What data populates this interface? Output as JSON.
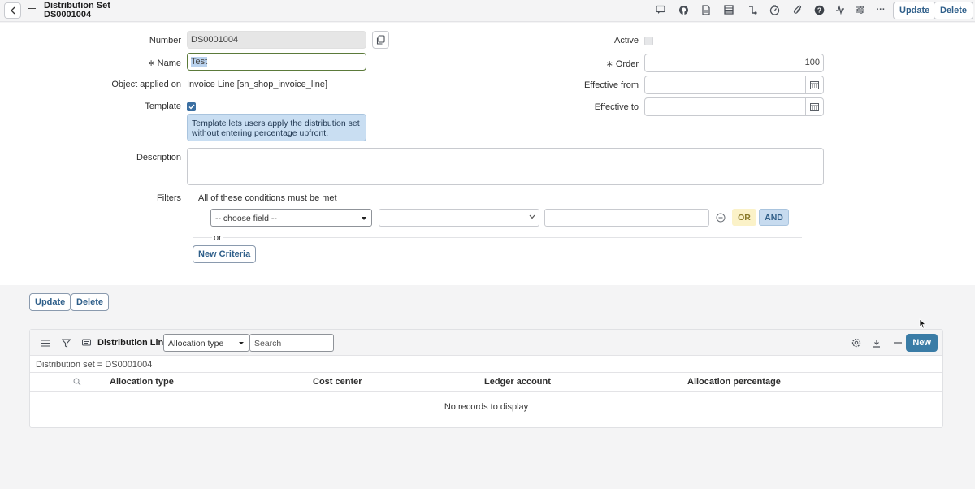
{
  "header": {
    "title": "Distribution Set",
    "record_id": "DS0001004",
    "update_label": "Update",
    "delete_label": "Delete",
    "more_label": "···"
  },
  "form": {
    "number_label": "Number",
    "number_value": "DS0001004",
    "name_label": "Name",
    "name_value": "Test",
    "required_mark": "∗",
    "object_label": "Object applied on",
    "object_value": "Invoice Line [sn_shop_invoice_line]",
    "template_label": "Template",
    "template_checked": true,
    "template_tooltip_line1": "Template lets users apply the distribution set",
    "template_tooltip_line2": "without entering percentage upfront.",
    "description_label": "Description",
    "description_value": "",
    "active_label": "Active",
    "active_checked": false,
    "order_label": "Order",
    "order_value": "100",
    "effective_from_label": "Effective from",
    "effective_from_value": "",
    "effective_to_label": "Effective to",
    "effective_to_value": "",
    "filters_label": "Filters",
    "filters_condition_text": "All of these conditions must be met",
    "choose_field": "-- choose field --",
    "operator_value": "",
    "filter_value": "",
    "or_label": "OR",
    "and_label": "AND",
    "or_separator": "or",
    "new_criteria_label": "New Criteria"
  },
  "footer_buttons": {
    "update_label": "Update",
    "delete_label": "Delete"
  },
  "related_list": {
    "title": "Distribution Lines",
    "search_field_selected": "Allocation type",
    "search_placeholder": "Search",
    "new_label": "New",
    "filter_breadcrumb": "Distribution set = DS0001004",
    "columns": [
      "Allocation type",
      "Cost center",
      "Ledger account",
      "Allocation percentage"
    ],
    "empty_message": "No records to display"
  }
}
